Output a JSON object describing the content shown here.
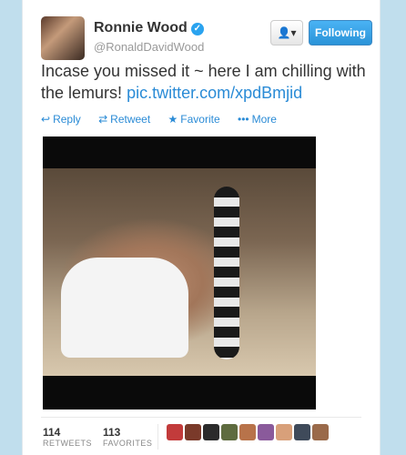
{
  "user": {
    "name": "Ronnie Wood",
    "handle": "@RonaldDavidWood",
    "verified_glyph": "✓"
  },
  "buttons": {
    "user_menu_icon": "👤▾",
    "follow_label": "Following"
  },
  "tweet": {
    "text": "Incase you missed it ~ here I am chilling with the lemurs!",
    "link": "pic.twitter.com/xpdBmjid"
  },
  "actions": [
    {
      "icon": "reply-icon",
      "glyph": "↩",
      "label": "Reply"
    },
    {
      "icon": "retweet-icon",
      "glyph": "⇄",
      "label": "Retweet"
    },
    {
      "icon": "favorite-icon",
      "glyph": "★",
      "label": "Favorite"
    },
    {
      "icon": "more-icon",
      "glyph": "•••",
      "label": "More"
    }
  ],
  "stats": {
    "retweets": {
      "count": "114",
      "label": "RETWEETS"
    },
    "favorites": {
      "count": "113",
      "label": "FAVORITES"
    }
  },
  "colors": {
    "accent": "#2a8bd6",
    "follow_button": "#2a93d8",
    "background": "#c0deed"
  },
  "favoriter_avatars": [
    "#c23b3b",
    "#7a3a2a",
    "#2b2b2b",
    "#5e6b3f",
    "#b8734a",
    "#8a5a9b",
    "#d8a07a",
    "#3f4a5a",
    "#9a6a4a"
  ]
}
